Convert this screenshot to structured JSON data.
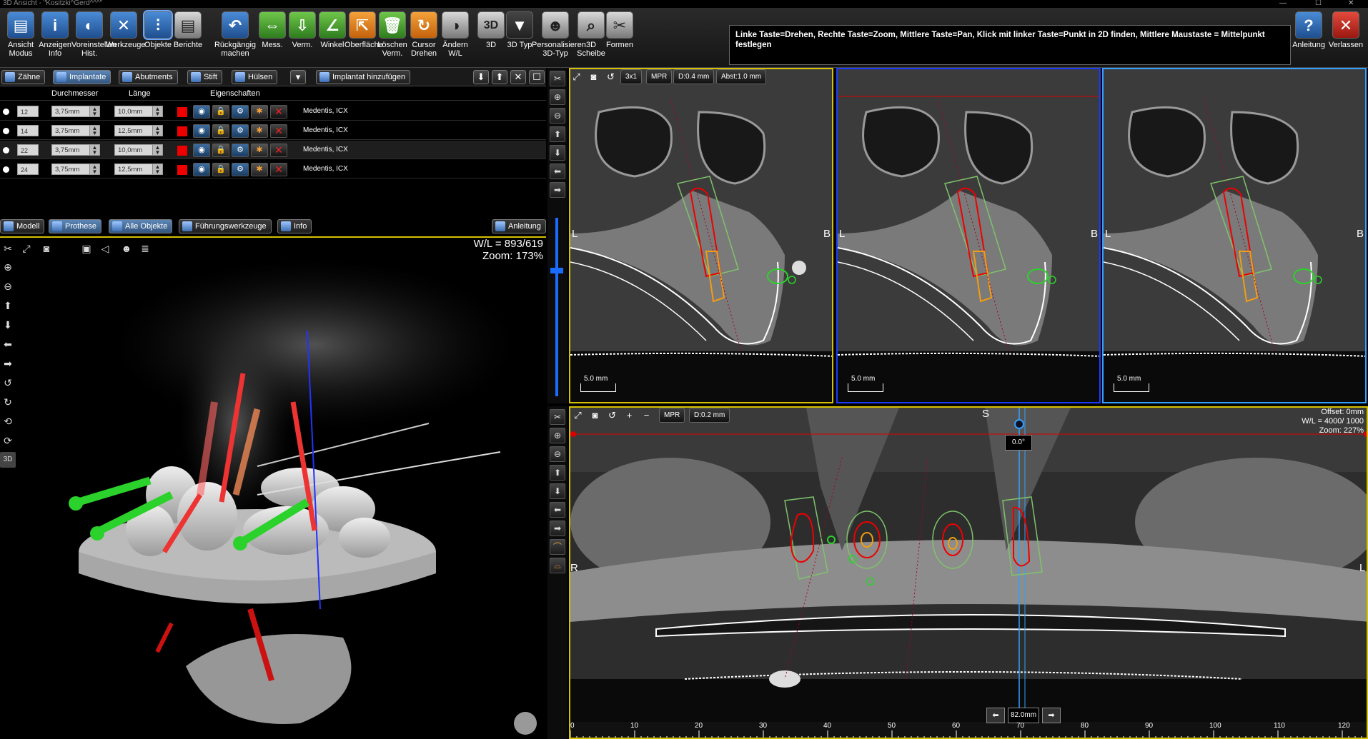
{
  "window": {
    "title": "3D Ansicht  -  \"Kositzki^Gerd^^^\""
  },
  "toolbar": {
    "buttons": [
      {
        "label": "Ansicht\nModus",
        "icon": "view-mode-icon"
      },
      {
        "label": "Anzeigen\nInfo",
        "icon": "info-icon"
      },
      {
        "label": "Voreinstellen\nHist.",
        "icon": "histogram-preset-icon"
      },
      {
        "label": "Werkzeuge",
        "icon": "tools-icon"
      },
      {
        "label": "Objekte",
        "icon": "implant-object-icon"
      },
      {
        "label": "Berichte",
        "icon": "report-icon"
      },
      {
        "label": "Rückgängig machen",
        "icon": "undo-icon"
      },
      {
        "label": "Mess.",
        "icon": "measure-icon"
      },
      {
        "label": "Verm.",
        "icon": "download-icon"
      },
      {
        "label": "Winkel",
        "icon": "angle-icon"
      },
      {
        "label": "Oberfläche",
        "icon": "surface-icon"
      },
      {
        "label": "Löschen\nVerm.",
        "icon": "trash-icon"
      },
      {
        "label": "Cursor\nDrehen",
        "icon": "cursor-rotate-icon"
      },
      {
        "label": "Ändern\nW/L",
        "icon": "window-level-icon"
      },
      {
        "label": "3D",
        "icon": "3d-icon"
      },
      {
        "label": "3D Typ",
        "icon": "3d-type-icon"
      },
      {
        "label": "Personalisieren\n3D-Typ",
        "icon": "personalize-3d-icon"
      },
      {
        "label": "3D\nScheibe",
        "icon": "3d-slice-icon"
      },
      {
        "label": "Formen",
        "icon": "scissors-icon"
      }
    ],
    "hint": "Linke Taste=Drehen, Rechte Taste=Zoom, Mittlere Taste=Pan, Klick mit linker Taste=Punkt in 2D finden, Mittlere Maustaste = Mittelpunkt festlegen",
    "help_label": "Anleitung",
    "exit_label": "Verlassen"
  },
  "top_tabs": {
    "items": [
      "Zähne",
      "Implantate",
      "Abutments",
      "Stift",
      "Hülsen"
    ],
    "active": "Implantate",
    "add_implant": "Implantat hinzufügen"
  },
  "implants": {
    "columns": {
      "diameter": "Durchmesser",
      "length": "Länge",
      "properties": "Eigenschaften"
    },
    "rows": [
      {
        "tooth": "12",
        "diameter": "3,75mm",
        "length": "10,0mm",
        "manufacturer": "Medentis, ICX"
      },
      {
        "tooth": "14",
        "diameter": "3,75mm",
        "length": "12,5mm",
        "manufacturer": "Medentis, ICX"
      },
      {
        "tooth": "22",
        "diameter": "3,75mm",
        "length": "10,0mm",
        "manufacturer": "Medentis, ICX"
      },
      {
        "tooth": "24",
        "diameter": "3,75mm",
        "length": "12,5mm",
        "manufacturer": "Medentis, ICX"
      }
    ],
    "color": "#e00000"
  },
  "lower_tabs": {
    "items": [
      "Modell",
      "Prothese",
      "Alle Objekte",
      "Führungswerkzeuge",
      "Info"
    ],
    "help": "Anleitung"
  },
  "view3d": {
    "wl": "W/L = 893/619",
    "zoom": "Zoom: 173%"
  },
  "cross_sections": {
    "buttons": [
      "3x1",
      "MPR",
      "D:0.4 mm",
      "Abst:1.0 mm"
    ],
    "left_label": "L",
    "right_label": "B",
    "scale": "5.0 mm"
  },
  "panoramic": {
    "buttons": [
      "MPR",
      "D:0.2 mm"
    ],
    "top_label": "S",
    "left_label": "R",
    "right_label": "L",
    "offset": "Offset: 0mm",
    "wl": "W/L = 4000/ 1000",
    "zoom": "Zoom: 227%",
    "angle": "0.0°",
    "position": "82.0mm",
    "ruler_ticks": [
      "0",
      "10",
      "20",
      "30",
      "40",
      "50",
      "60",
      "70",
      "80",
      "90",
      "100",
      "110",
      "120"
    ]
  },
  "colors": {
    "accent_yellow": "#d6c100",
    "accent_blue": "#1a6cff",
    "implant_red": "#e00000",
    "implant_orange": "#f39c12",
    "abutment_green": "#22c322"
  }
}
